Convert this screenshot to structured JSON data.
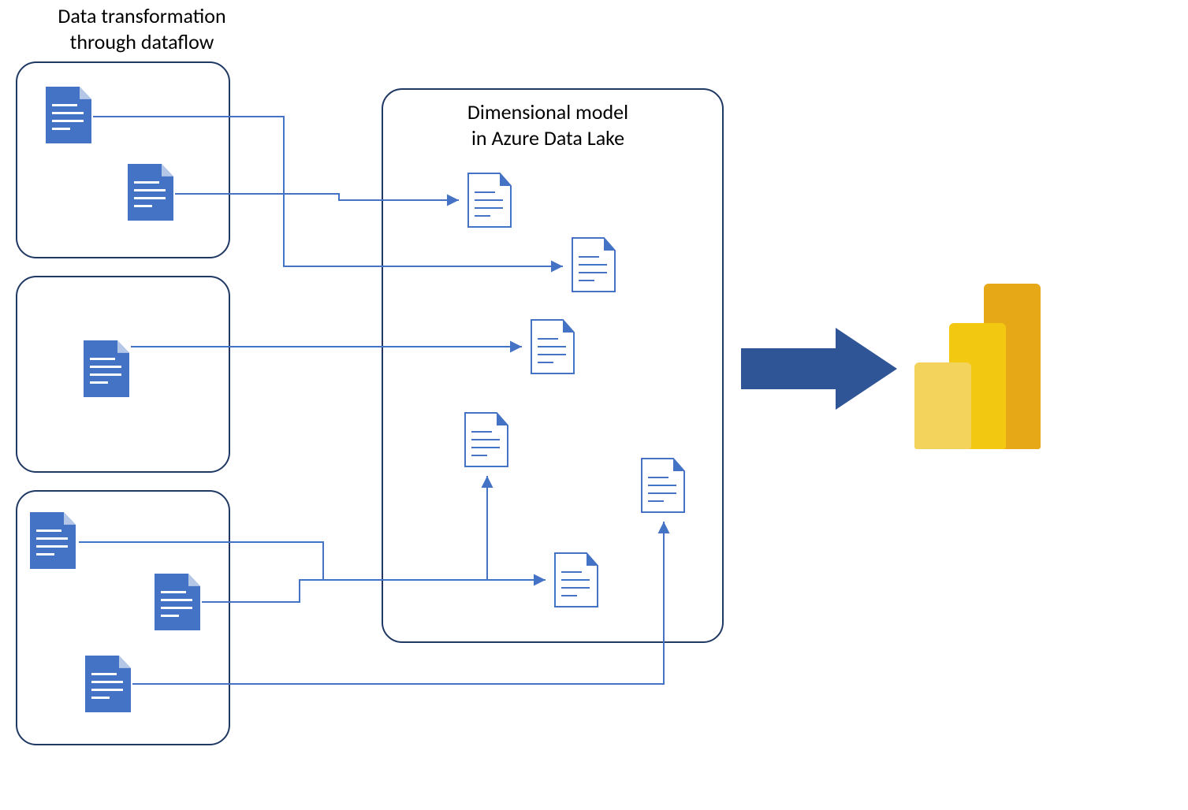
{
  "left_title_line1": "Data transformation",
  "left_title_line2": "through dataflow",
  "center_title_line1": "Dimensional model",
  "center_title_line2": "in Azure Data Lake",
  "colors": {
    "box_border": "#203864",
    "doc_fill": "#4472C4",
    "doc_fold": "#B4C7E7",
    "doc_outline_stroke": "#4472C4",
    "doc_outline_fold": "#4472C4",
    "connector": "#4472C4",
    "big_arrow": "#2F5597",
    "pbi_dark": "#E6A817",
    "pbi_mid": "#F2C811",
    "pbi_light": "#F3D35C"
  },
  "diagram": {
    "left_groups": 3,
    "source_docs": 6,
    "lake_docs": 6,
    "connectors": 8
  }
}
